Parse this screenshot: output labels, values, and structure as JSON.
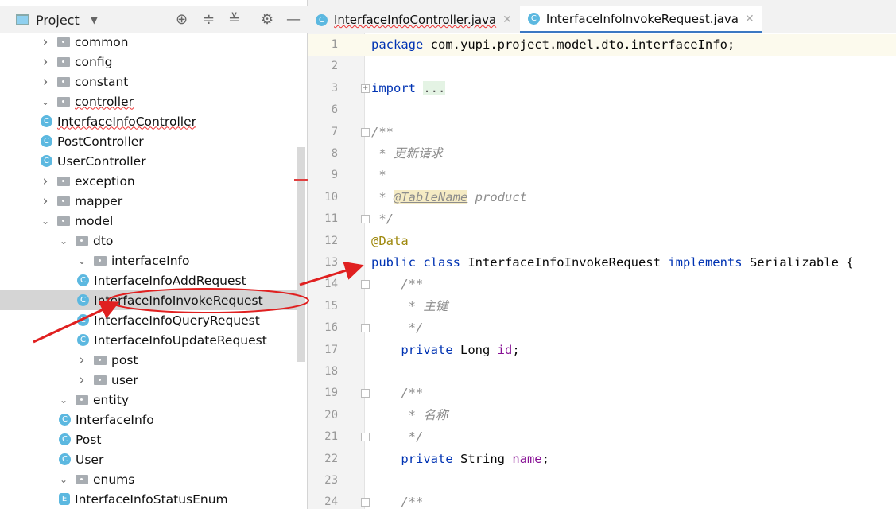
{
  "project_panel": {
    "title": "Project",
    "icons": [
      "locate-icon",
      "expand-all-icon",
      "collapse-all-icon",
      "gear-icon",
      "minimize-icon"
    ],
    "tree": [
      {
        "label": "common",
        "type": "folder",
        "depth": 0,
        "expanded": false
      },
      {
        "label": "config",
        "type": "folder",
        "depth": 0,
        "expanded": false
      },
      {
        "label": "constant",
        "type": "folder",
        "depth": 0,
        "expanded": false
      },
      {
        "label": "controller",
        "type": "folder",
        "depth": 0,
        "expanded": true,
        "error": true
      },
      {
        "label": "InterfaceInfoController",
        "type": "class",
        "depth": 1,
        "error": true
      },
      {
        "label": "PostController",
        "type": "class",
        "depth": 1
      },
      {
        "label": "UserController",
        "type": "class",
        "depth": 1
      },
      {
        "label": "exception",
        "type": "folder",
        "depth": 0,
        "expanded": false
      },
      {
        "label": "mapper",
        "type": "folder",
        "depth": 0,
        "expanded": false
      },
      {
        "label": "model",
        "type": "folder",
        "depth": 0,
        "expanded": true
      },
      {
        "label": "dto",
        "type": "folder",
        "depth": 1,
        "expanded": true
      },
      {
        "label": "interfaceInfo",
        "type": "folder",
        "depth": 2,
        "expanded": true
      },
      {
        "label": "InterfaceInfoAddRequest",
        "type": "class",
        "depth": 3
      },
      {
        "label": "InterfaceInfoInvokeRequest",
        "type": "class",
        "depth": 3,
        "selected": true
      },
      {
        "label": "InterfaceInfoQueryRequest",
        "type": "class",
        "depth": 3
      },
      {
        "label": "InterfaceInfoUpdateRequest",
        "type": "class",
        "depth": 3
      },
      {
        "label": "post",
        "type": "folder",
        "depth": 2,
        "expanded": false
      },
      {
        "label": "user",
        "type": "folder",
        "depth": 2,
        "expanded": false
      },
      {
        "label": "entity",
        "type": "folder",
        "depth": 1,
        "expanded": true
      },
      {
        "label": "InterfaceInfo",
        "type": "class",
        "depth": 2
      },
      {
        "label": "Post",
        "type": "class",
        "depth": 2
      },
      {
        "label": "User",
        "type": "class",
        "depth": 2
      },
      {
        "label": "enums",
        "type": "folder",
        "depth": 1,
        "expanded": true
      },
      {
        "label": "InterfaceInfoStatusEnum",
        "type": "enum",
        "depth": 2
      }
    ]
  },
  "tabs": [
    {
      "label": "InterfaceInfoController.java",
      "active": false,
      "error": true
    },
    {
      "label": "InterfaceInfoInvokeRequest.java",
      "active": true
    }
  ],
  "editor": {
    "lines": [
      {
        "n": "1",
        "t": [
          [
            "package",
            "kw"
          ],
          [
            " com.yupi.project.model.dto.interfaceInfo;",
            ""
          ]
        ]
      },
      {
        "n": "2",
        "t": []
      },
      {
        "n": "3",
        "t": [
          [
            "import",
            "kw"
          ],
          [
            " ",
            ""
          ],
          [
            "...",
            "fo"
          ]
        ],
        "fold": "+"
      },
      {
        "n": "6",
        "t": []
      },
      {
        "n": "7",
        "t": [
          [
            "/**",
            "cm"
          ]
        ],
        "fold": "-"
      },
      {
        "n": "8",
        "t": [
          [
            " * 更新请求",
            "cm"
          ]
        ]
      },
      {
        "n": "9",
        "t": [
          [
            " *",
            "cm"
          ]
        ]
      },
      {
        "n": "10",
        "t": [
          [
            " * ",
            "cm"
          ],
          [
            "@TableName",
            "tg"
          ],
          [
            " product",
            "cm"
          ]
        ]
      },
      {
        "n": "11",
        "t": [
          [
            " */",
            "cm"
          ]
        ],
        "fold": "-"
      },
      {
        "n": "12",
        "t": [
          [
            "@Data",
            "an"
          ]
        ]
      },
      {
        "n": "13",
        "t": [
          [
            "public class",
            "kw"
          ],
          [
            " InterfaceInfoInvokeRequest ",
            ""
          ],
          [
            "implements",
            "kw"
          ],
          [
            " Serializable {",
            ""
          ]
        ]
      },
      {
        "n": "14",
        "t": [
          [
            "    /**",
            "cm"
          ]
        ],
        "fold": "-"
      },
      {
        "n": "15",
        "t": [
          [
            "     * 主键",
            "cm"
          ]
        ]
      },
      {
        "n": "16",
        "t": [
          [
            "     */",
            "cm"
          ]
        ],
        "fold": "-"
      },
      {
        "n": "17",
        "t": [
          [
            "    ",
            "kw"
          ],
          [
            "private",
            "kw"
          ],
          [
            " Long ",
            ""
          ],
          [
            "id",
            "fd"
          ],
          [
            ";",
            ""
          ]
        ]
      },
      {
        "n": "18",
        "t": []
      },
      {
        "n": "19",
        "t": [
          [
            "    /**",
            "cm"
          ]
        ],
        "fold": "-"
      },
      {
        "n": "20",
        "t": [
          [
            "     * 名称",
            "cm"
          ]
        ]
      },
      {
        "n": "21",
        "t": [
          [
            "     */",
            "cm"
          ]
        ],
        "fold": "-"
      },
      {
        "n": "22",
        "t": [
          [
            "    ",
            "kw"
          ],
          [
            "private",
            "kw"
          ],
          [
            " String ",
            ""
          ],
          [
            "name",
            "fd"
          ],
          [
            ";",
            ""
          ]
        ]
      },
      {
        "n": "23",
        "t": []
      },
      {
        "n": "24",
        "t": [
          [
            "    /**",
            "cm"
          ]
        ],
        "fold": "-"
      }
    ]
  },
  "colors": {
    "annotation_arrow": "#e02020",
    "active_tab": "#3b78c2"
  }
}
